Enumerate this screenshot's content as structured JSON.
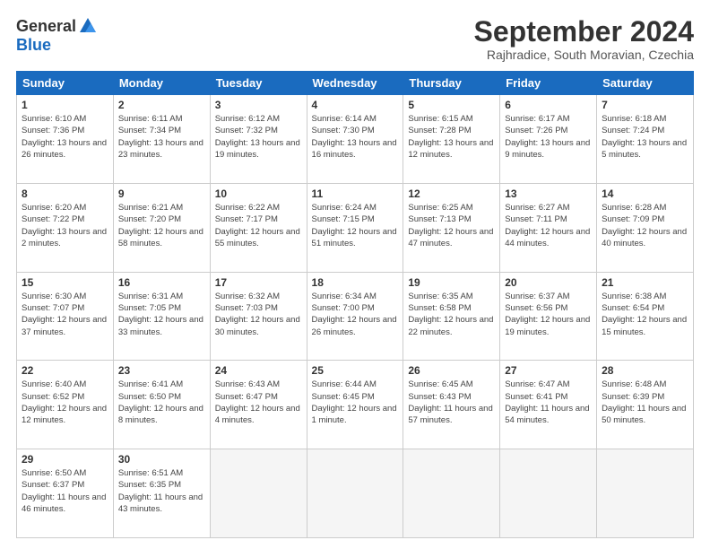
{
  "logo": {
    "general": "General",
    "blue": "Blue"
  },
  "title": "September 2024",
  "subtitle": "Rajhradice, South Moravian, Czechia",
  "weekdays": [
    "Sunday",
    "Monday",
    "Tuesday",
    "Wednesday",
    "Thursday",
    "Friday",
    "Saturday"
  ],
  "weeks": [
    [
      {
        "day": "1",
        "info": "Sunrise: 6:10 AM\nSunset: 7:36 PM\nDaylight: 13 hours and 26 minutes."
      },
      {
        "day": "2",
        "info": "Sunrise: 6:11 AM\nSunset: 7:34 PM\nDaylight: 13 hours and 23 minutes."
      },
      {
        "day": "3",
        "info": "Sunrise: 6:12 AM\nSunset: 7:32 PM\nDaylight: 13 hours and 19 minutes."
      },
      {
        "day": "4",
        "info": "Sunrise: 6:14 AM\nSunset: 7:30 PM\nDaylight: 13 hours and 16 minutes."
      },
      {
        "day": "5",
        "info": "Sunrise: 6:15 AM\nSunset: 7:28 PM\nDaylight: 13 hours and 12 minutes."
      },
      {
        "day": "6",
        "info": "Sunrise: 6:17 AM\nSunset: 7:26 PM\nDaylight: 13 hours and 9 minutes."
      },
      {
        "day": "7",
        "info": "Sunrise: 6:18 AM\nSunset: 7:24 PM\nDaylight: 13 hours and 5 minutes."
      }
    ],
    [
      {
        "day": "8",
        "info": "Sunrise: 6:20 AM\nSunset: 7:22 PM\nDaylight: 13 hours and 2 minutes."
      },
      {
        "day": "9",
        "info": "Sunrise: 6:21 AM\nSunset: 7:20 PM\nDaylight: 12 hours and 58 minutes."
      },
      {
        "day": "10",
        "info": "Sunrise: 6:22 AM\nSunset: 7:17 PM\nDaylight: 12 hours and 55 minutes."
      },
      {
        "day": "11",
        "info": "Sunrise: 6:24 AM\nSunset: 7:15 PM\nDaylight: 12 hours and 51 minutes."
      },
      {
        "day": "12",
        "info": "Sunrise: 6:25 AM\nSunset: 7:13 PM\nDaylight: 12 hours and 47 minutes."
      },
      {
        "day": "13",
        "info": "Sunrise: 6:27 AM\nSunset: 7:11 PM\nDaylight: 12 hours and 44 minutes."
      },
      {
        "day": "14",
        "info": "Sunrise: 6:28 AM\nSunset: 7:09 PM\nDaylight: 12 hours and 40 minutes."
      }
    ],
    [
      {
        "day": "15",
        "info": "Sunrise: 6:30 AM\nSunset: 7:07 PM\nDaylight: 12 hours and 37 minutes."
      },
      {
        "day": "16",
        "info": "Sunrise: 6:31 AM\nSunset: 7:05 PM\nDaylight: 12 hours and 33 minutes."
      },
      {
        "day": "17",
        "info": "Sunrise: 6:32 AM\nSunset: 7:03 PM\nDaylight: 12 hours and 30 minutes."
      },
      {
        "day": "18",
        "info": "Sunrise: 6:34 AM\nSunset: 7:00 PM\nDaylight: 12 hours and 26 minutes."
      },
      {
        "day": "19",
        "info": "Sunrise: 6:35 AM\nSunset: 6:58 PM\nDaylight: 12 hours and 22 minutes."
      },
      {
        "day": "20",
        "info": "Sunrise: 6:37 AM\nSunset: 6:56 PM\nDaylight: 12 hours and 19 minutes."
      },
      {
        "day": "21",
        "info": "Sunrise: 6:38 AM\nSunset: 6:54 PM\nDaylight: 12 hours and 15 minutes."
      }
    ],
    [
      {
        "day": "22",
        "info": "Sunrise: 6:40 AM\nSunset: 6:52 PM\nDaylight: 12 hours and 12 minutes."
      },
      {
        "day": "23",
        "info": "Sunrise: 6:41 AM\nSunset: 6:50 PM\nDaylight: 12 hours and 8 minutes."
      },
      {
        "day": "24",
        "info": "Sunrise: 6:43 AM\nSunset: 6:47 PM\nDaylight: 12 hours and 4 minutes."
      },
      {
        "day": "25",
        "info": "Sunrise: 6:44 AM\nSunset: 6:45 PM\nDaylight: 12 hours and 1 minute."
      },
      {
        "day": "26",
        "info": "Sunrise: 6:45 AM\nSunset: 6:43 PM\nDaylight: 11 hours and 57 minutes."
      },
      {
        "day": "27",
        "info": "Sunrise: 6:47 AM\nSunset: 6:41 PM\nDaylight: 11 hours and 54 minutes."
      },
      {
        "day": "28",
        "info": "Sunrise: 6:48 AM\nSunset: 6:39 PM\nDaylight: 11 hours and 50 minutes."
      }
    ],
    [
      {
        "day": "29",
        "info": "Sunrise: 6:50 AM\nSunset: 6:37 PM\nDaylight: 11 hours and 46 minutes."
      },
      {
        "day": "30",
        "info": "Sunrise: 6:51 AM\nSunset: 6:35 PM\nDaylight: 11 hours and 43 minutes."
      },
      {
        "day": "",
        "info": ""
      },
      {
        "day": "",
        "info": ""
      },
      {
        "day": "",
        "info": ""
      },
      {
        "day": "",
        "info": ""
      },
      {
        "day": "",
        "info": ""
      }
    ]
  ]
}
